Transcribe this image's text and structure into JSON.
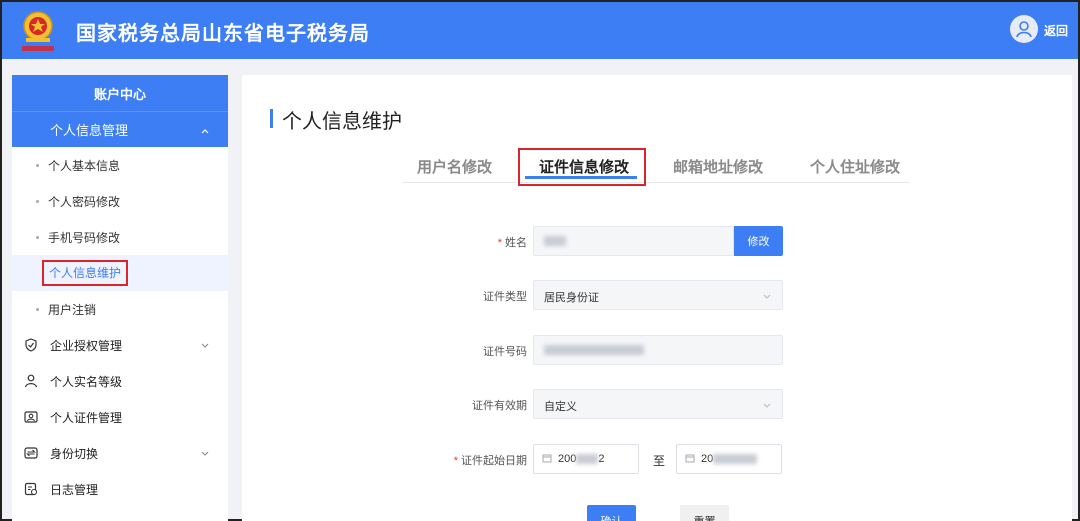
{
  "header": {
    "title": "国家税务总局山东省电子税务局",
    "back_label": "返回"
  },
  "sidebar": {
    "heading": "账户中心",
    "group": {
      "label": "个人信息管理"
    },
    "sub_items": [
      {
        "label": "个人基本信息"
      },
      {
        "label": "个人密码修改"
      },
      {
        "label": "手机号码修改"
      },
      {
        "label": "个人信息维护"
      },
      {
        "label": "用户注销"
      }
    ],
    "items": [
      {
        "label": "企业授权管理",
        "icon": "shield-check-icon"
      },
      {
        "label": "个人实名等级",
        "icon": "user-icon"
      },
      {
        "label": "个人证件管理",
        "icon": "id-card-icon"
      },
      {
        "label": "身份切换",
        "icon": "switch-icon"
      },
      {
        "label": "日志管理",
        "icon": "log-icon"
      }
    ]
  },
  "main": {
    "title": "个人信息维护",
    "tabs": [
      {
        "label": "用户名修改"
      },
      {
        "label": "证件信息修改"
      },
      {
        "label": "邮箱地址修改"
      },
      {
        "label": "个人住址修改"
      }
    ],
    "form": {
      "name_label": "姓名",
      "modify_label": "修改",
      "id_type_label": "证件类型",
      "id_type_value": "居民身份证",
      "id_number_label": "证件号码",
      "validity_label": "证件有效期",
      "validity_value": "自定义",
      "start_date_label": "证件起始日期",
      "start_date_value": "200",
      "start_date_suffix": "2",
      "date_separator": "至",
      "end_date_value": "20"
    },
    "confirm_label": "确认",
    "reset_label": "重置"
  },
  "colors": {
    "primary": "#3d7ef5",
    "highlight": "#d9262c",
    "required": "#e53935"
  }
}
